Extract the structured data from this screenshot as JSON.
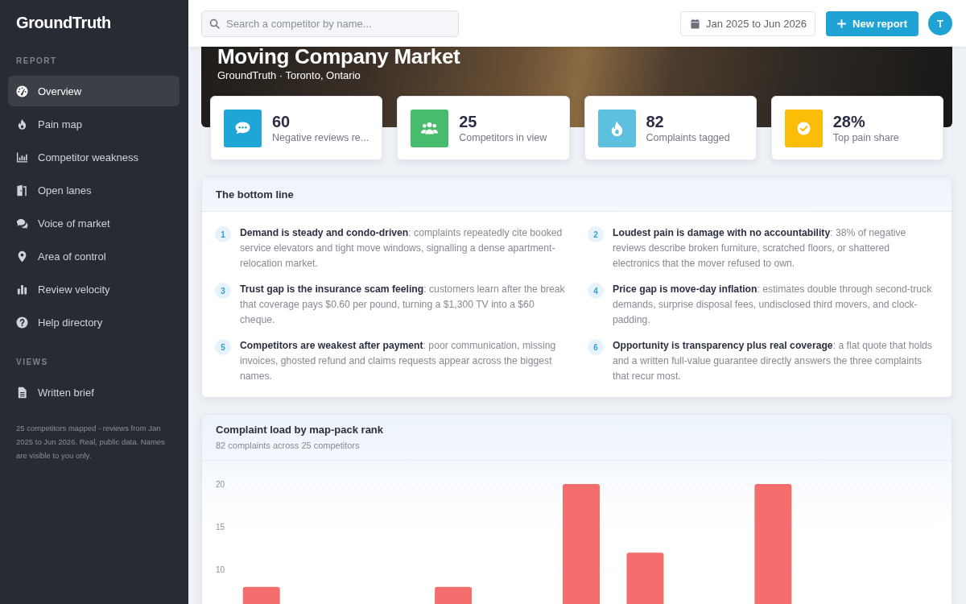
{
  "sidebar": {
    "logo": "GroundTruth",
    "sections": [
      {
        "title": "REPORT",
        "items": [
          {
            "label": "Overview",
            "selected": true
          },
          {
            "label": "Pain map",
            "selected": false
          },
          {
            "label": "Competitor weakness",
            "selected": false
          },
          {
            "label": "Open lanes",
            "selected": false
          },
          {
            "label": "Voice of market",
            "selected": false
          },
          {
            "label": "Area of control",
            "selected": false
          },
          {
            "label": "Review velocity",
            "selected": false
          },
          {
            "label": "Help directory",
            "selected": false
          }
        ]
      },
      {
        "title": "VIEWS",
        "items": [
          {
            "label": "Written brief",
            "selected": false
          }
        ]
      }
    ],
    "footer": "25 competitors mapped - reviews from Jan 2025 to Jun 2026. Real, public data. Names are visible to you only."
  },
  "topbar": {
    "search": {
      "placeholder": "Search a competitor by name..."
    },
    "date_range": "Jan 2025 to Jun 2026",
    "new_report_button": "New report",
    "avatar": "T"
  },
  "hero": {
    "title": "Moving Company Market",
    "subtitle": "GroundTruth · Toronto, Ontario"
  },
  "stats": [
    {
      "value": "60",
      "label": "Negative reviews re...",
      "color": "#1fa5d6"
    },
    {
      "value": "25",
      "label": "Competitors in view",
      "color": "#48bb6c"
    },
    {
      "value": "82",
      "label": "Complaints tagged",
      "color": "#5dc0de"
    },
    {
      "value": "28%",
      "label": "Top pain share",
      "color": "#fbbd08"
    }
  ],
  "bottom_line": {
    "title": "The bottom line",
    "points": [
      {
        "number": "1",
        "text": "**Demand is steady and condo-driven**: complaints repeatedly cite booked service elevators and tight move windows, signalling a dense apartment-relocation market."
      },
      {
        "number": "2",
        "text": "**Loudest pain is damage with no accountability**: 38% of negative reviews describe broken furniture, scratched floors, or shattered electronics that the mover refused to own."
      },
      {
        "number": "3",
        "text": "**Trust gap is the insurance scam feeling**: customers learn after the break that coverage pays $0.60 per pound, turning a $1,300 TV into a $60 cheque."
      },
      {
        "number": "4",
        "text": "**Price gap is move-day inflation**: estimates double through second-truck demands, surprise disposal fees, undisclosed third movers, and clock-padding."
      },
      {
        "number": "5",
        "text": "**Competitors are weakest after payment**: poor communication, missing invoices, ghosted refund and claims requests appear across the biggest names."
      },
      {
        "number": "6",
        "text": "**Opportunity is transparency plus real coverage**: a flat quote that holds and a written full-value guarantee directly answers the three complaints that recur most."
      }
    ]
  },
  "complaint_chart": {
    "title": "Complaint load by map-pack rank",
    "subtitle": "82 complaints across 25 competitors",
    "chart_data": {
      "type": "bar",
      "values": [
        8,
        null,
        null,
        8,
        null,
        20,
        12,
        null,
        20,
        null,
        null
      ],
      "ylim": [
        6,
        20
      ],
      "yticks": [
        10,
        15,
        20
      ]
    }
  }
}
